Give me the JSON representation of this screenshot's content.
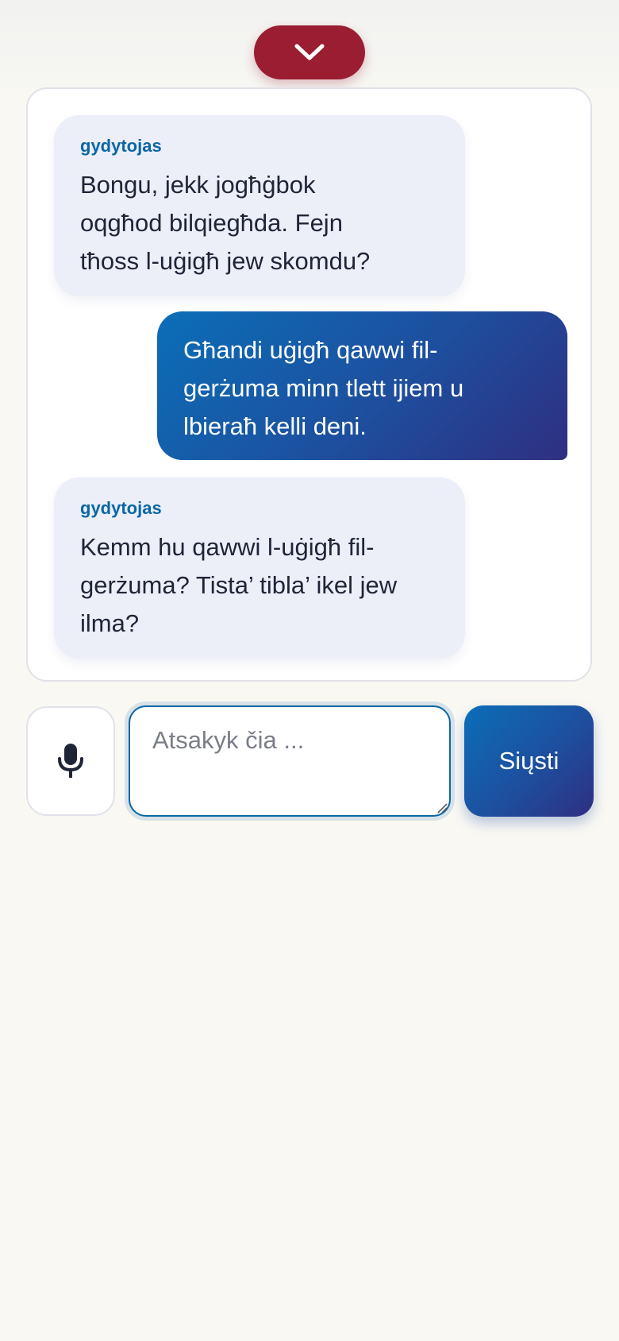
{
  "header": {
    "collapse_icon": "chevron-down-icon"
  },
  "messages": [
    {
      "role": "bot",
      "sender": "gydytojas",
      "lines": [
        "Bongu, jekk jogħġbok",
        "oqgħod bilqiegħda. Fejn",
        "tħoss l-uġigħ jew skomdu?"
      ]
    },
    {
      "role": "user",
      "lines": [
        "Għandi uġigħ qawwi fil-",
        "gerżuma minn tlett ijiem u",
        "lbieraħ kelli deni."
      ]
    },
    {
      "role": "bot",
      "sender": "gydytojas",
      "lines": [
        "Kemm hu qawwi l-uġigħ fil-",
        "gerżuma? Tista’ tibla’ ikel jew",
        "ilma?"
      ]
    }
  ],
  "composer": {
    "mic_icon": "microphone-icon",
    "placeholder": "Atsakyk čia ...",
    "value": "",
    "send_label": "Siųsti"
  },
  "colors": {
    "accent_red": "#9b1d32",
    "accent_blue": "#0b67a5",
    "user_bubble_start": "#0b6eb8",
    "user_bubble_end": "#2f2f82",
    "bot_bubble": "#eceef8",
    "page_background": "#f9f8f3"
  }
}
